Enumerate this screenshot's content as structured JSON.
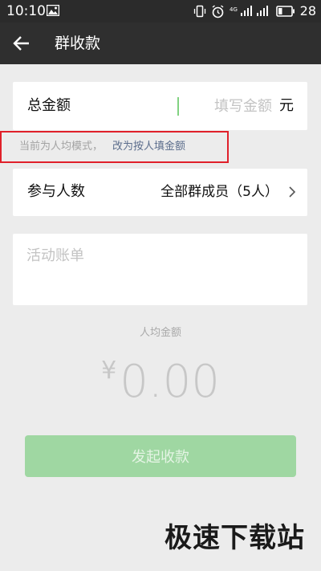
{
  "status_bar": {
    "time": "10:10",
    "network_label": "4G",
    "battery_level": "28"
  },
  "app_bar": {
    "title": "群收款",
    "back_icon": "arrow-left-icon"
  },
  "total_amount": {
    "label": "总金额",
    "placeholder": "填写金额",
    "value": "",
    "unit": "元"
  },
  "mode_hint": {
    "text": "当前为人均模式，",
    "link": "改为按人填金额"
  },
  "participants": {
    "label": "参与人数",
    "value": "全部群成员（5人）",
    "chevron_icon": "chevron-right-icon"
  },
  "memo": {
    "placeholder": "活动账单",
    "value": ""
  },
  "per_person": {
    "label": "人均金额",
    "currency": "¥",
    "amount": "0.00"
  },
  "submit_button": {
    "label": "发起收款"
  },
  "watermark": {
    "text": "极速下载站"
  },
  "colors": {
    "status_bar": "#2b2b2b",
    "app_bar": "#2f2f2f",
    "background": "#ececec",
    "highlight_border": "#e0202a",
    "link": "#5b6d8c",
    "submit_disabled": "#9fd7a2"
  }
}
